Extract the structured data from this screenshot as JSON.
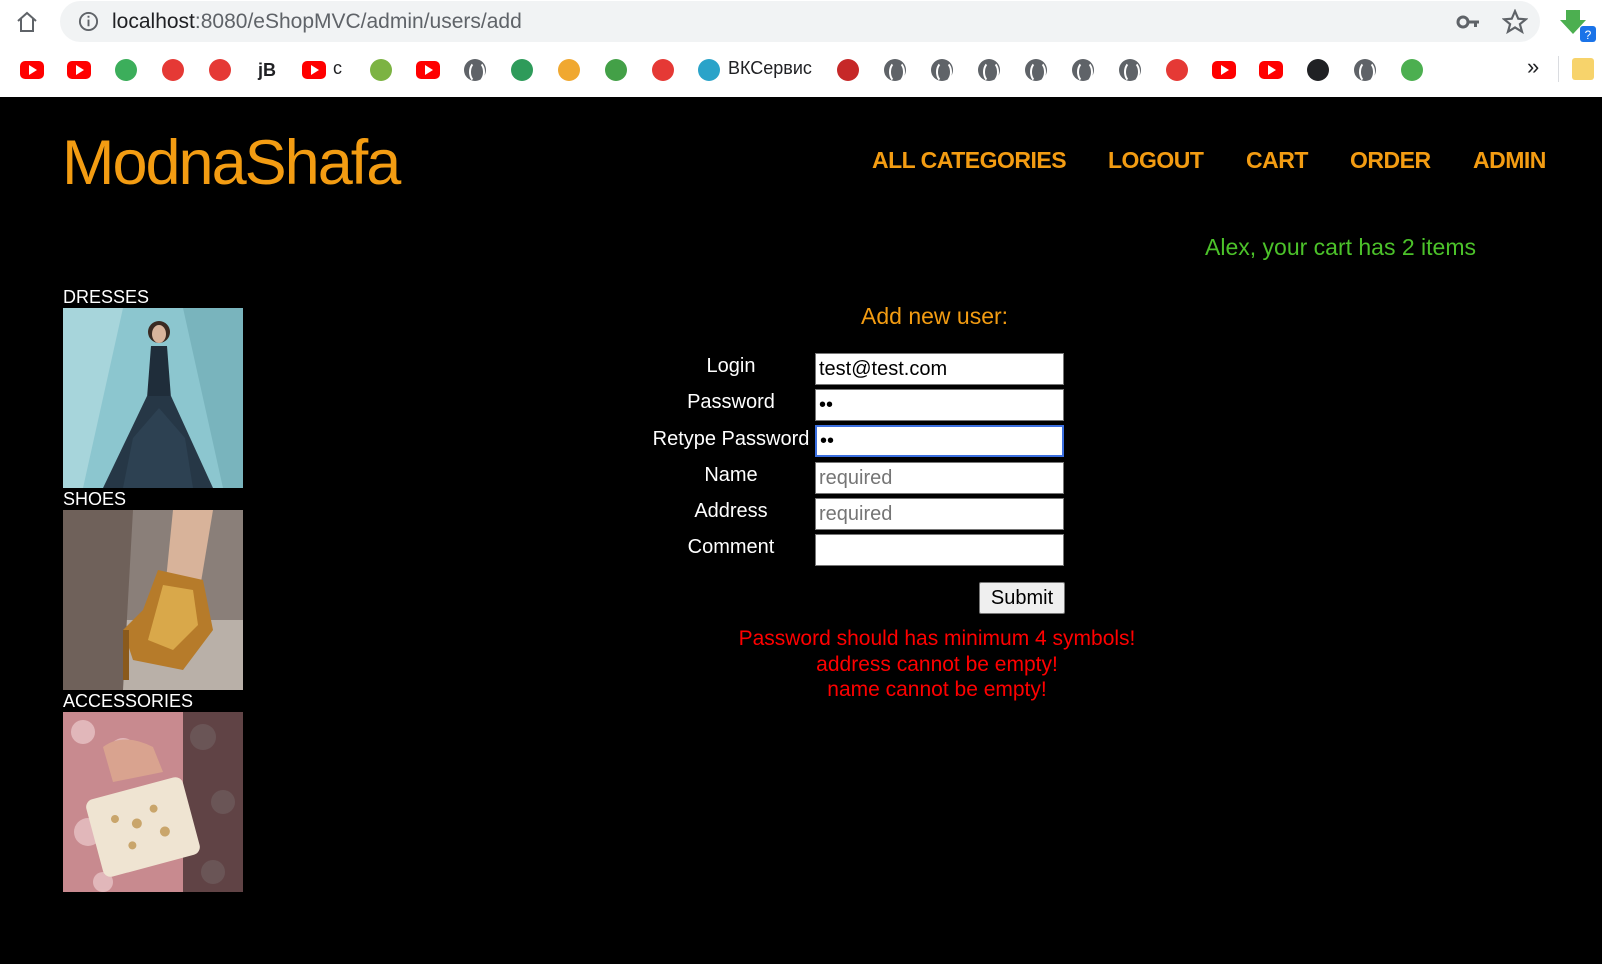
{
  "browser": {
    "url_host": "localhost",
    "url_path": ":8080/eShopMVC/admin/users/add",
    "bookmarks": [
      {
        "icon": "youtube-icon"
      },
      {
        "icon": "youtube-icon"
      },
      {
        "icon": "refresh-green-icon"
      },
      {
        "icon": "red-circle-icon"
      },
      {
        "icon": "question-icon"
      },
      {
        "icon": "jb-icon",
        "text": "jB"
      },
      {
        "icon": "youtube-icon",
        "text": "c"
      },
      {
        "icon": "apple-icon"
      },
      {
        "icon": "youtube-icon"
      },
      {
        "icon": "globe-icon"
      },
      {
        "icon": "green-circle-icon"
      },
      {
        "icon": "coins-icon"
      },
      {
        "icon": "leaf-icon"
      },
      {
        "icon": "feather-icon"
      },
      {
        "icon": "vk-service-icon",
        "text": "ВКСервис"
      },
      {
        "icon": "house-icon"
      },
      {
        "icon": "globe-icon"
      },
      {
        "icon": "globe-icon"
      },
      {
        "icon": "globe-icon"
      },
      {
        "icon": "globe-icon"
      },
      {
        "icon": "globe-icon"
      },
      {
        "icon": "globe-icon"
      },
      {
        "icon": "red-cross-icon"
      },
      {
        "icon": "youtube-icon"
      },
      {
        "icon": "youtube-icon"
      },
      {
        "icon": "a-icon"
      },
      {
        "icon": "globe-icon"
      },
      {
        "icon": "green-leaf-icon"
      }
    ],
    "more_label": "»"
  },
  "site": {
    "logo": "ModnaShafa",
    "nav": [
      "ALL CATEGORIES",
      "LOGOUT",
      "CART",
      "ORDER",
      "ADMIN"
    ],
    "cart_message": "Alex, your cart has 2 items",
    "accent_color": "#f39c12",
    "cart_color": "#4cc22a",
    "error_color": "#ff0000"
  },
  "categories": [
    {
      "label": "DRESSES"
    },
    {
      "label": "SHOES"
    },
    {
      "label": "ACCESSORIES"
    }
  ],
  "form": {
    "title": "Add new user:",
    "fields": [
      {
        "label": "Login",
        "value": "test@test.com",
        "placeholder": ""
      },
      {
        "label": "Password",
        "value": "••",
        "placeholder": ""
      },
      {
        "label": "Retype Password",
        "value": "••",
        "placeholder": ""
      },
      {
        "label": "Name",
        "value": "",
        "placeholder": "required"
      },
      {
        "label": "Address",
        "value": "",
        "placeholder": "required"
      },
      {
        "label": "Comment",
        "value": "",
        "placeholder": ""
      }
    ],
    "submit_label": "Submit",
    "errors": [
      "Password should has minimum 4 symbols!",
      "address cannot be empty!",
      "name cannot be empty!"
    ]
  }
}
